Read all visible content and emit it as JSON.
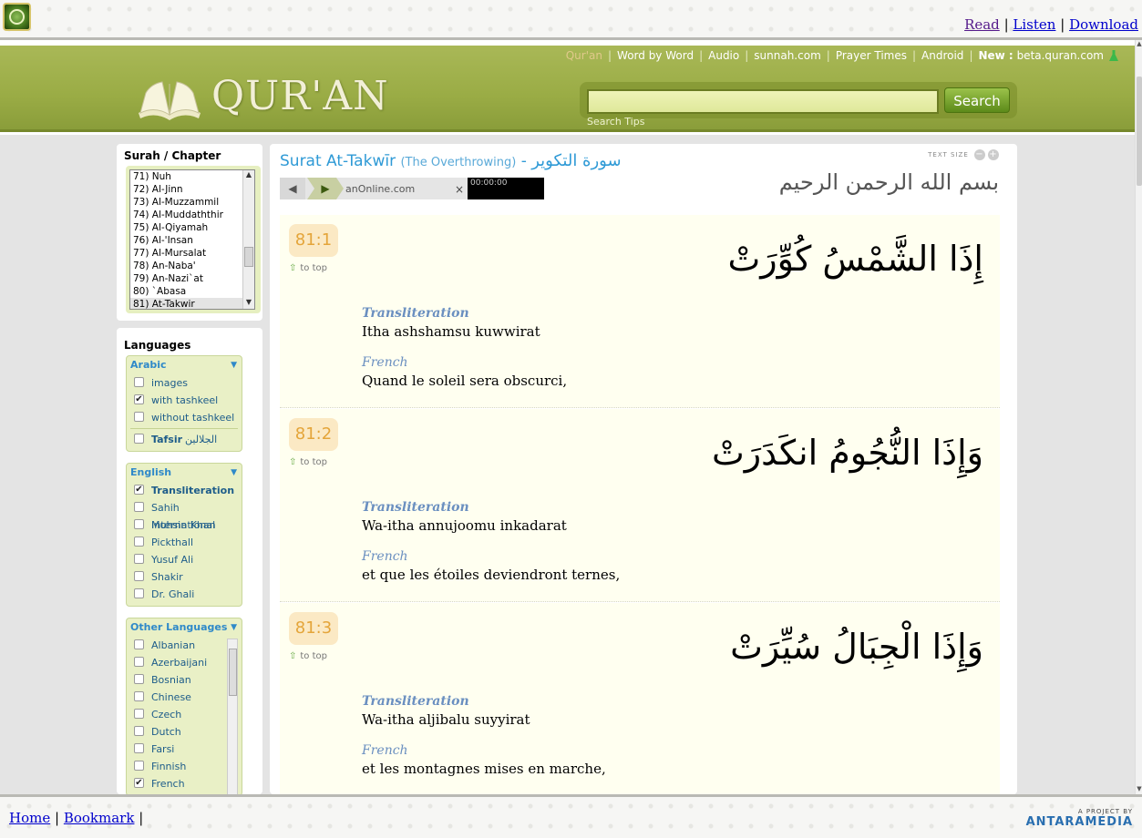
{
  "top": {
    "links": [
      "Read",
      "Listen",
      "Download"
    ],
    "separator": "|"
  },
  "nav": {
    "items": [
      "Qur'an",
      "Word by Word",
      "Audio",
      "sunnah.com",
      "Prayer Times",
      "Android"
    ],
    "new_label": "New :",
    "new_link": "beta.quran.com"
  },
  "brand": {
    "name": "QUR'AN"
  },
  "search": {
    "button": "Search",
    "tips": "Search Tips",
    "value": ""
  },
  "sidebar": {
    "surah_title": "Surah / Chapter",
    "surahs": [
      "71) Nuh",
      "72) Al-Jinn",
      "73) Al-Muzzammil",
      "74) Al-Muddaththir",
      "75) Al-Qiyamah",
      "76) Al-'Insan",
      "77) Al-Mursalat",
      "78) An-Naba'",
      "79) An-Nazi`at",
      "80) `Abasa",
      "81) At-Takwir"
    ],
    "selected_surah": "81) At-Takwir",
    "languages_title": "Languages",
    "arabic": {
      "title": "Arabic",
      "options": [
        {
          "label": "images",
          "checked": false
        },
        {
          "label": "with tashkeel",
          "checked": true
        },
        {
          "label": "without tashkeel",
          "checked": false
        }
      ],
      "tafsir_label": "Tafsir",
      "tafsir_arabic": "الجلالين"
    },
    "english": {
      "title": "English",
      "options": [
        {
          "label": "Transliteration",
          "checked": true
        },
        {
          "label": "Sahih International",
          "checked": false
        },
        {
          "label": "Muhsin Khan",
          "checked": false
        },
        {
          "label": "Pickthall",
          "checked": false
        },
        {
          "label": "Yusuf Ali",
          "checked": false
        },
        {
          "label": "Shakir",
          "checked": false
        },
        {
          "label": "Dr. Ghali",
          "checked": false
        }
      ]
    },
    "other": {
      "title": "Other Languages",
      "options": [
        {
          "label": "Albanian",
          "checked": false
        },
        {
          "label": "Azerbaijani",
          "checked": false
        },
        {
          "label": "Bosnian",
          "checked": false
        },
        {
          "label": "Chinese",
          "checked": false
        },
        {
          "label": "Czech",
          "checked": false
        },
        {
          "label": "Dutch",
          "checked": false
        },
        {
          "label": "Farsi",
          "checked": false
        },
        {
          "label": "Finnish",
          "checked": false
        },
        {
          "label": "French",
          "checked": true
        }
      ]
    }
  },
  "content": {
    "surah_name": "Surat At-Takwīr",
    "surah_translation": "(The Overthrowing)",
    "dash": "-",
    "surah_arabic": "سورة التكوير",
    "text_size_label": "TEXT SIZE",
    "bismillah": "بسم الله الرحمن الرحيم",
    "player": {
      "source": "anOnline.com",
      "time": "00:00:00",
      "close": "×"
    },
    "to_top": "to top",
    "transliteration_label": "Transliteration",
    "french_label": "French",
    "verses": [
      {
        "num": "81:1",
        "arabic": "إِذَا الشَّمْسُ كُوِّرَتْ",
        "translit": "Itha ashshamsu kuwwirat",
        "french": "Quand le soleil sera obscurci,"
      },
      {
        "num": "81:2",
        "arabic": "وَإِذَا النُّجُومُ انكَدَرَتْ",
        "translit": "Wa-itha annujoomu inkadarat",
        "french": "et que les étoiles deviendront ternes,"
      },
      {
        "num": "81:3",
        "arabic": "وَإِذَا الْجِبَالُ سُيِّرَتْ",
        "translit": "Wa-itha aljibalu suyyirat",
        "french": "et les montagnes mises en marche,"
      }
    ]
  },
  "bottom": {
    "links": [
      "Home",
      "Bookmark"
    ],
    "separator": "|",
    "credit_small": "A PROJECT BY",
    "credit_big": "ANTARAMEDIA"
  }
}
